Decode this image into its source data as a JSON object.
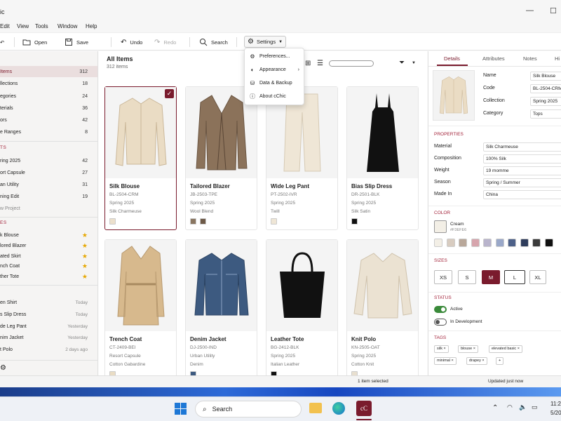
{
  "app": {
    "title_fragment": "ic"
  },
  "menu": [
    "Edit",
    "View",
    "Tools",
    "Window",
    "Help"
  ],
  "toolbar": {
    "open": "Open",
    "save": "Save",
    "undo": "Undo",
    "redo": "Redo",
    "search": "Search",
    "settings": "Settings"
  },
  "settings_menu": [
    {
      "label": "Preferences...",
      "icon": "gear-icon"
    },
    {
      "label": "Appearance",
      "icon": "palette-icon",
      "submenu": true
    },
    {
      "label": "Data & Backup",
      "icon": "database-icon"
    },
    {
      "label": "About cChic",
      "icon": "info-icon"
    }
  ],
  "sidebar": {
    "library": [
      {
        "label": "Items",
        "count": "312",
        "active": true
      },
      {
        "label": "llections",
        "count": "18"
      },
      {
        "label": "egories",
        "count": "24"
      },
      {
        "label": "terials",
        "count": "36"
      },
      {
        "label": "ors",
        "count": "42"
      },
      {
        "label": "e Ranges",
        "count": "8"
      }
    ],
    "collections_head": "TS",
    "collections": [
      {
        "label": "ring 2025",
        "count": "42"
      },
      {
        "label": "ort Capsule",
        "count": "27"
      },
      {
        "label": "an Utility",
        "count": "31"
      },
      {
        "label": "ning Edit",
        "count": "19"
      }
    ],
    "new_project": "w Project",
    "favorites_head": "ES",
    "favorites": [
      "k Blouse",
      "lored Blazer",
      "ated Skirt",
      "nch Coat",
      "ther Tote"
    ],
    "recent": [
      {
        "label": "en Shirt",
        "time": "Today"
      },
      {
        "label": "s Slip Dress",
        "time": "Today"
      },
      {
        "label": "de Leg Pant",
        "time": "Yesterday"
      },
      {
        "label": "nim Jacket",
        "time": "Yesterday"
      },
      {
        "label": "t Polo",
        "time": "2 days ago"
      }
    ]
  },
  "grid": {
    "title": "All Items",
    "subtitle": "312 items",
    "cards": [
      {
        "name": "Silk Blouse",
        "code": "BL-2504-CRM",
        "collection": "Spring 2025",
        "material": "Silk Charmeuse",
        "swatches": [
          "#ece0cc"
        ],
        "selected": true,
        "garment": "blouse"
      },
      {
        "name": "Tailored Blazer",
        "code": "JB-2503-TPE",
        "collection": "Spring 2025",
        "material": "Wool Blend",
        "swatches": [
          "#8a7661",
          "#6e5a48"
        ],
        "garment": "blazer"
      },
      {
        "name": "Wide Leg Pant",
        "code": "PT-2502-IVR",
        "collection": "Spring 2025",
        "material": "Twill",
        "swatches": [
          "#efe6d6"
        ],
        "garment": "pant"
      },
      {
        "name": "Bias Slip Dress",
        "code": "DR-2501-BLK",
        "collection": "Spring 2025",
        "material": "Silk Satin",
        "swatches": [
          "#111111"
        ],
        "garment": "dress"
      },
      {
        "name": "Trench Coat",
        "code": "CT-2409-BEI",
        "collection": "Resort Capsule",
        "material": "Cotton Gabardine",
        "swatches": [
          "#e9dcc4"
        ],
        "garment": "trench"
      },
      {
        "name": "Denim Jacket",
        "code": "DJ-2500-IND",
        "collection": "Urban Utility",
        "material": "Denim",
        "swatches": [
          "#3d5a80"
        ],
        "garment": "denim"
      },
      {
        "name": "Leather Tote",
        "code": "BG-2412-BLK",
        "collection": "Spring 2025",
        "material": "Italian Leather",
        "swatches": [
          "#111111"
        ],
        "garment": "tote"
      },
      {
        "name": "Knit Polo",
        "code": "KN-2505-OAT",
        "collection": "Spring 2025",
        "material": "Cotton Knit",
        "swatches": [
          "#e8dfcf"
        ],
        "garment": "polo"
      }
    ]
  },
  "details": {
    "tabs": [
      "Details",
      "Attributes",
      "Notes",
      "Hi"
    ],
    "fields": [
      {
        "k": "Name",
        "v": "Silk Blouse"
      },
      {
        "k": "Code",
        "v": "BL-2504-CRM"
      },
      {
        "k": "Collection",
        "v": "Spring 2025"
      },
      {
        "k": "Category",
        "v": "Tops"
      }
    ],
    "properties_head": "PROPERTIES",
    "properties": [
      {
        "k": "Material",
        "v": "Silk Charmeuse"
      },
      {
        "k": "Composition",
        "v": "100% Silk"
      },
      {
        "k": "Weight",
        "v": "19 momme"
      },
      {
        "k": "Season",
        "v": "Spring / Summer"
      },
      {
        "k": "Made In",
        "v": "China"
      }
    ],
    "color_head": "COLOR",
    "color_name": "Cream",
    "color_hex": "#F3EFE6",
    "palette": [
      "#f3efe6",
      "#d8ccc0",
      "#b9a89a",
      "#d7a5ad",
      "#b9b4cc",
      "#9aa8c9",
      "#4d6189",
      "#2f3d5c",
      "#3b3b3b",
      "#111111"
    ],
    "sizes_head": "SIZES",
    "sizes": [
      "XS",
      "S",
      "M",
      "L",
      "XL"
    ],
    "size_selected": "M",
    "size_outlined": "L",
    "status_head": "STATUS",
    "status": [
      {
        "label": "Active",
        "on": true
      },
      {
        "label": "In Development",
        "on": false
      }
    ],
    "tags_head": "TAGS",
    "tags": [
      "silk",
      "blouse",
      "elevated basic",
      "minimal",
      "drapey"
    ]
  },
  "status": {
    "selection": "1 item selected",
    "saved": "Updated just now"
  },
  "taskbar": {
    "search": "Search",
    "time": "11:2",
    "date": "5/20"
  },
  "accent": "#7a1b2d"
}
